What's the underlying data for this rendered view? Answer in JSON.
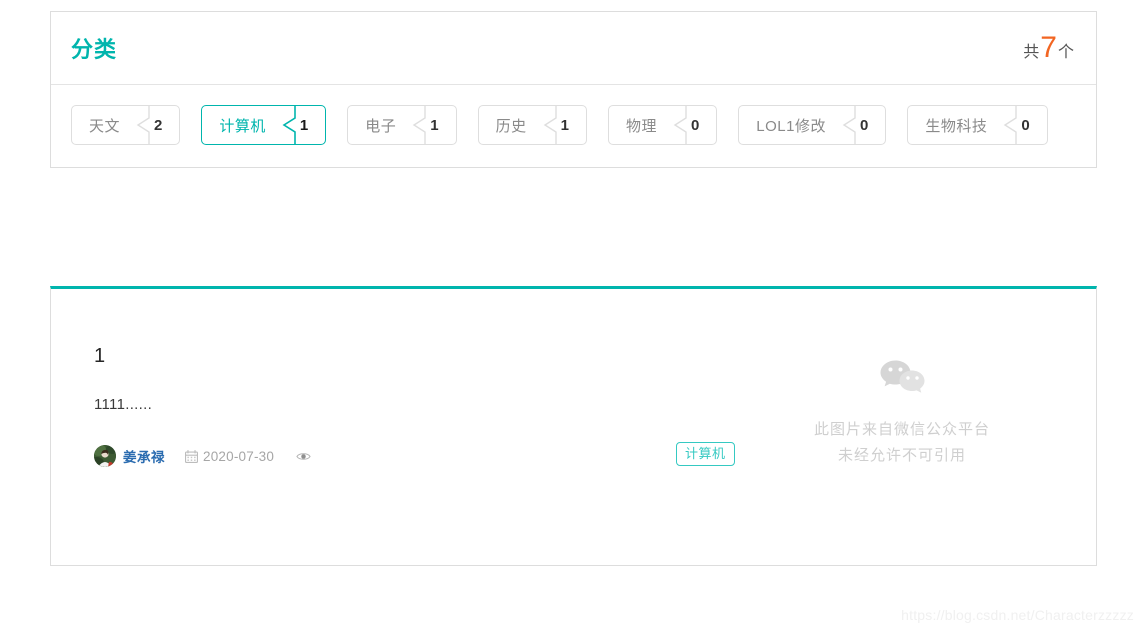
{
  "theme": {
    "accent_teal": "#00b5ad",
    "accent_orange": "#f26522",
    "link_blue": "#2b6cb0",
    "tag_teal": "#35c9c2",
    "border_gray": "#dddddd",
    "muted_text": "#8a8a8a"
  },
  "category_panel": {
    "title": "分类",
    "count_prefix": "共",
    "count_value": "7",
    "count_suffix": "个",
    "tags": [
      {
        "label": "天文",
        "count": "2",
        "active": false
      },
      {
        "label": "计算机",
        "count": "1",
        "active": true
      },
      {
        "label": "电子",
        "count": "1",
        "active": false
      },
      {
        "label": "历史",
        "count": "1",
        "active": false
      },
      {
        "label": "物理",
        "count": "0",
        "active": false
      },
      {
        "label": "LOL1修改",
        "count": "0",
        "active": false
      },
      {
        "label": "生物科技",
        "count": "0",
        "active": false
      }
    ]
  },
  "article": {
    "title": "1",
    "excerpt": "1111......",
    "author": "姜承禄",
    "date": "2020-07-30",
    "calendar_icon": "calendar-icon",
    "views_icon": "eye-icon",
    "avatar_icon": "avatar",
    "tag": "计算机",
    "thumbnail": {
      "icon": "wechat-icon",
      "line1": "此图片来自微信公众平台",
      "line2": "未经允许不可引用"
    }
  },
  "watermark": "https://blog.csdn.net/Characterzzzzz"
}
